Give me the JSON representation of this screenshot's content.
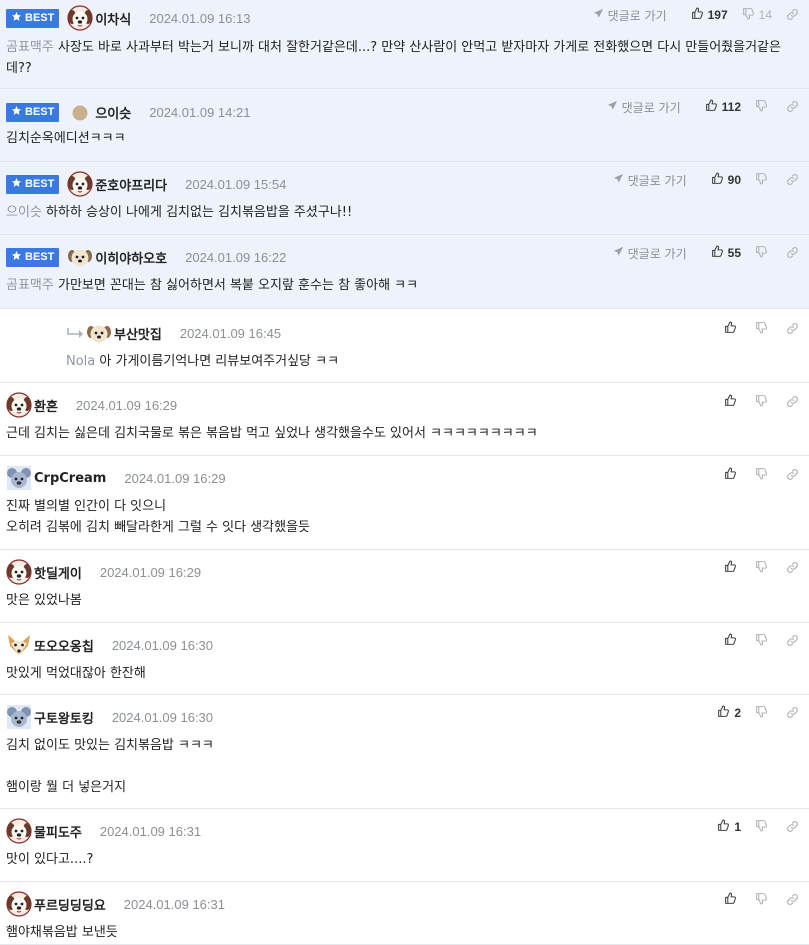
{
  "comments": [
    {
      "id": "c1",
      "best": true,
      "nick": "이차식",
      "date": "2024.01.09 16:13",
      "reply_label": "댓글로 가기",
      "likes": "197",
      "dislikes": "14",
      "mention": "곰표맥주",
      "lines": [
        "사장도 바로 사과부터 박는거 보니까 대처 잘한거같은데...? 만약 산사람이 안먹고 받자마자 가게로 전화했으면 다시 만들어줬을거같은데??"
      ],
      "avatar": "puppy"
    },
    {
      "id": "c2",
      "best": true,
      "nick": "으이슷",
      "date": "2024.01.09 14:21",
      "reply_label": "댓글로 가기",
      "likes": "112",
      "dislikes": "",
      "mention": "",
      "lines": [
        "김치순옥에디션ㅋㅋㅋ"
      ],
      "avatar": "dot"
    },
    {
      "id": "c3",
      "best": true,
      "nick": "준호야프리다",
      "date": "2024.01.09 15:54",
      "reply_label": "댓글로 가기",
      "likes": "90",
      "dislikes": "",
      "mention": "으이슷",
      "lines": [
        "하하하 승상이 나에게 김치없는 김치볶음밥을 주셨구나!!"
      ],
      "avatar": "puppy"
    },
    {
      "id": "c4",
      "best": true,
      "nick": "이히야하오호",
      "date": "2024.01.09 16:22",
      "reply_label": "댓글로 가기",
      "likes": "55",
      "dislikes": "",
      "mention": "곰표맥주",
      "lines": [
        "가만보면 꼰대는 참 싫어하면서 복붙 오지랖 훈수는 참 좋아해 ㅋㅋ"
      ],
      "avatar": "dog"
    },
    {
      "id": "c5",
      "best": false,
      "reply": true,
      "nick": "부산맛집",
      "date": "2024.01.09 16:45",
      "likes": "",
      "dislikes": "",
      "mention": "Nola",
      "lines": [
        "아 가게이름기억나면 리뷰보여주거싶당 ㅋㅋ"
      ],
      "avatar": "dog"
    },
    {
      "id": "c6",
      "best": false,
      "nick": "환혼",
      "date": "2024.01.09 16:29",
      "likes": "",
      "dislikes": "",
      "mention": "",
      "lines": [
        "근데 김치는 싫은데 김치국물로 볶은 볶음밥 먹고 싶었나 생각했을수도 있어서 ㅋㅋㅋㅋㅋㅋㅋㅋㅋ"
      ],
      "avatar": "puppy"
    },
    {
      "id": "c7",
      "best": false,
      "nick": "CrpCream",
      "date": "2024.01.09 16:29",
      "likes": "",
      "dislikes": "",
      "mention": "",
      "lines": [
        "진짜 별의별 인간이 다 잇으니",
        "오히려 김볶에 김치 빼달라한게 그럴 수 잇다 생각했을듯"
      ],
      "avatar": "koala"
    },
    {
      "id": "c8",
      "best": false,
      "nick": "핫딜게이",
      "date": "2024.01.09 16:29",
      "likes": "",
      "dislikes": "",
      "mention": "",
      "lines": [
        "맛은 있었나봄"
      ],
      "avatar": "puppy"
    },
    {
      "id": "c9",
      "best": false,
      "nick": "또오오옹칩",
      "date": "2024.01.09 16:30",
      "likes": "",
      "dislikes": "",
      "mention": "",
      "lines": [
        "맛있게 먹었대잖아 한잔해"
      ],
      "avatar": "fox"
    },
    {
      "id": "c10",
      "best": false,
      "nick": "구토왕토킹",
      "date": "2024.01.09 16:30",
      "likes": "2",
      "dislikes": "",
      "mention": "",
      "lines": [
        "김치 없이도 맛있는 김치볶음밥 ㅋㅋㅋ",
        "",
        "햄이랑 뭘 더 넣은거지"
      ],
      "avatar": "koala"
    },
    {
      "id": "c11",
      "best": false,
      "nick": "물피도주",
      "date": "2024.01.09 16:31",
      "likes": "1",
      "dislikes": "",
      "mention": "",
      "lines": [
        "맛이 있다고....?"
      ],
      "avatar": "puppy"
    },
    {
      "id": "c12",
      "best": false,
      "nick": "푸르딩딩딩요",
      "date": "2024.01.09 16:31",
      "likes": "",
      "dislikes": "",
      "mention": "",
      "lines": [
        "햄야채볶음밥 보낸듯"
      ],
      "avatar": "puppy"
    }
  ],
  "badge_label": "BEST",
  "colors": {
    "accent": "#3a79e0",
    "best_bg": "#eef3fb",
    "muted": "#8a8f96",
    "mention": "#8f97a3"
  },
  "icons": {
    "badge": "star-icon",
    "reply": "paper-plane-icon",
    "like": "thumbs-up-icon",
    "dislike": "thumbs-down-icon",
    "link": "link-icon"
  }
}
